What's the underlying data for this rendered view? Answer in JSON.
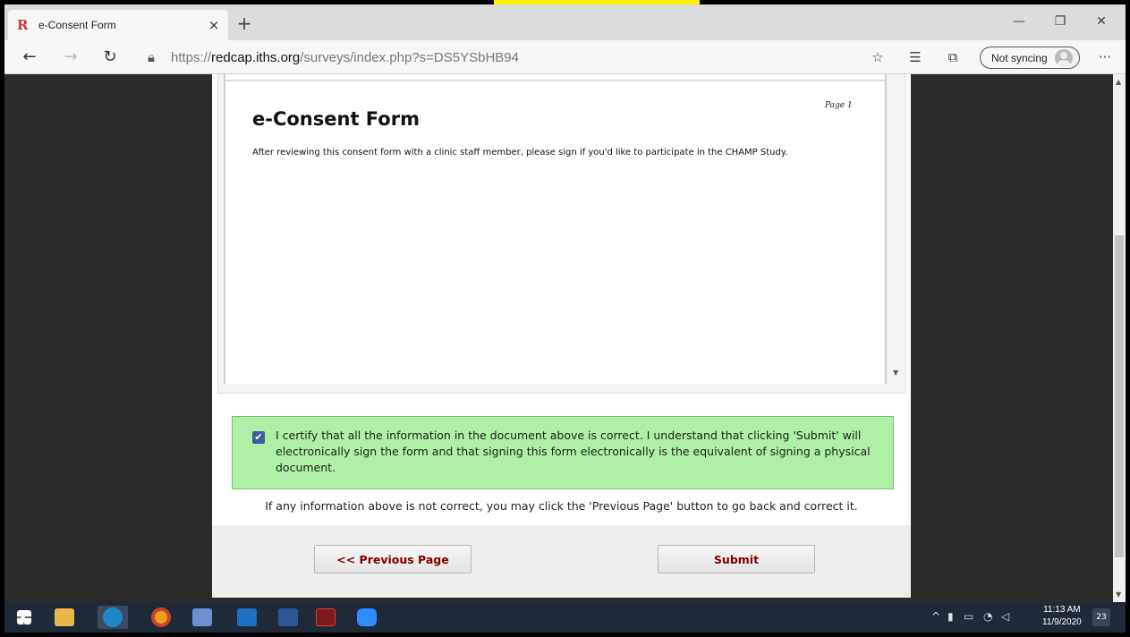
{
  "browser": {
    "tab_title": "e-Consent Form",
    "tab_close": "×",
    "new_tab": "+",
    "url_prefix": "https://",
    "url_host": "redcap.iths.org",
    "url_path": "/surveys/index.php?s=DS5YSbHB94",
    "sync_label": "Not syncing",
    "more": "···"
  },
  "form": {
    "page_label": "Page 1",
    "title": "e-Consent Form",
    "description": "After reviewing this consent form with a clinic staff member, please sign if you'd like to participate in the CHAMP Study.",
    "certify_checked": true,
    "certify_text": "I certify that all the information in the document above is correct. I understand that clicking 'Submit' will electronically sign the form and that signing this form electronically is the equivalent of signing a physical document.",
    "info_note": "If any information above is not correct, you may click the 'Previous Page' button to go back and correct it.",
    "prev_button": "<< Previous Page",
    "submit_button": "Submit"
  },
  "taskbar": {
    "time": "11:13 AM",
    "date": "11/9/2020",
    "notifications": "23"
  },
  "colors": {
    "cert_bg": "#aef0a6",
    "button_text": "#800000",
    "taskbar": "#1f2a38"
  }
}
